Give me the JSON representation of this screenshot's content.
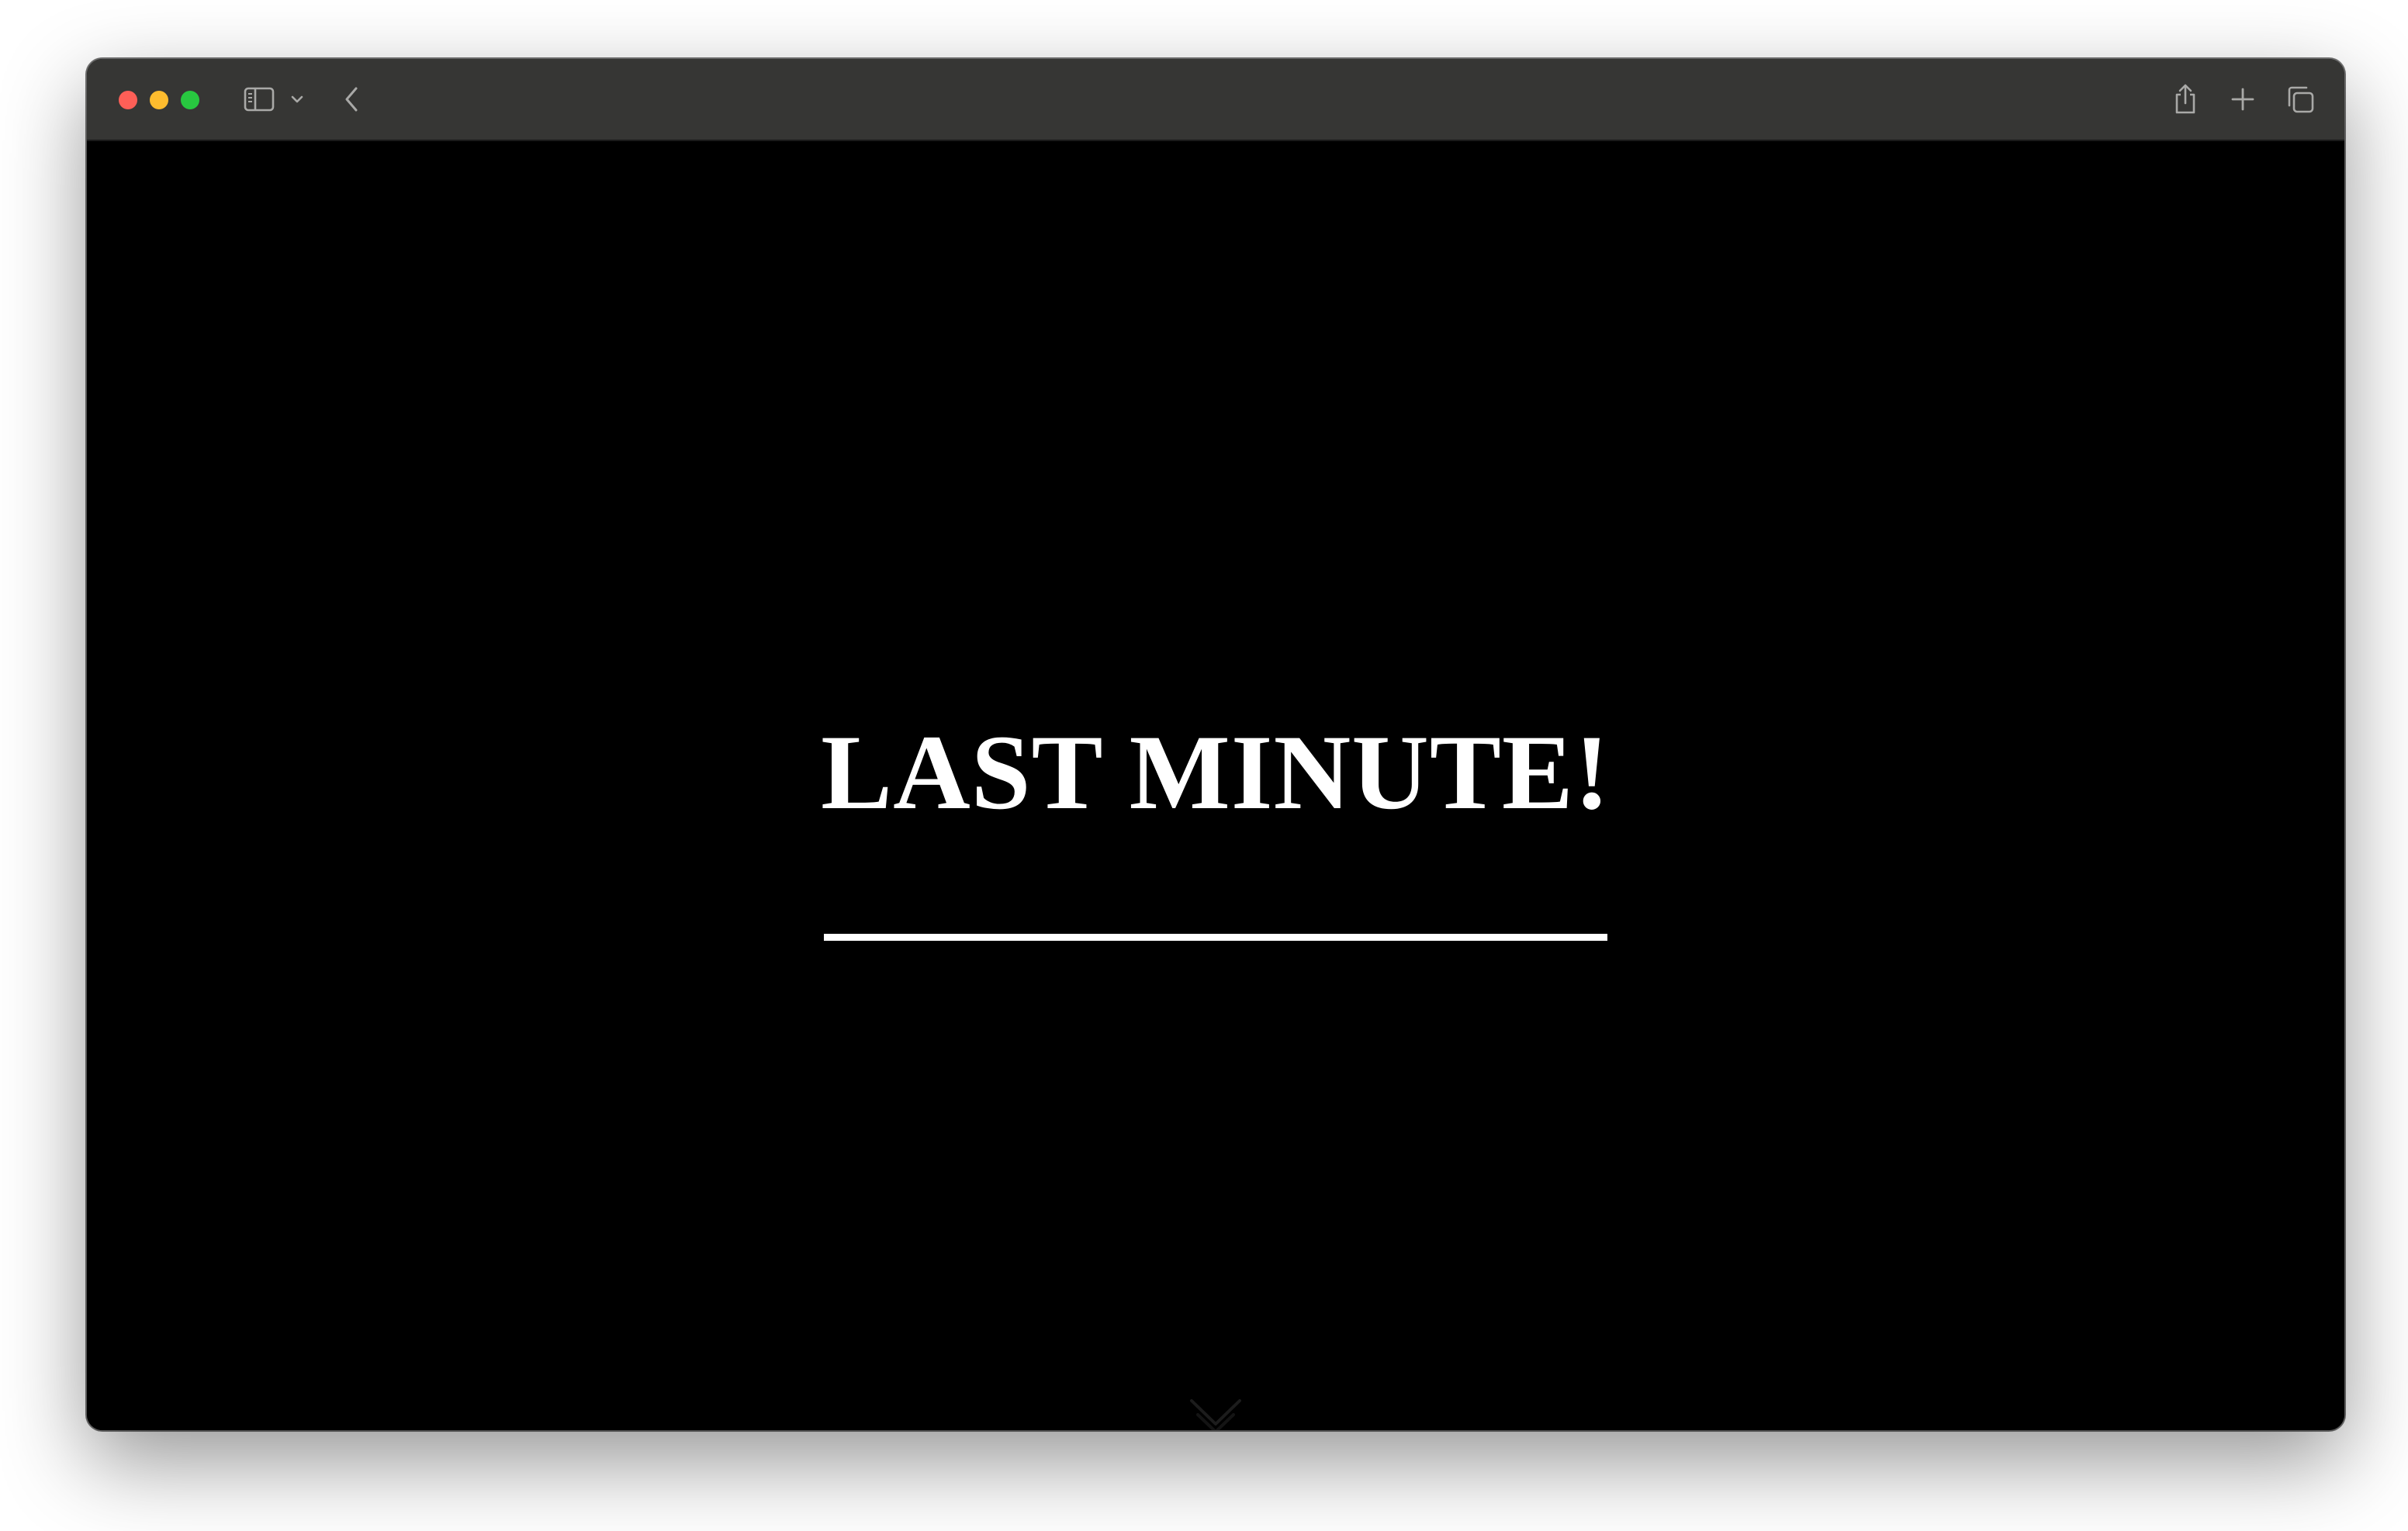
{
  "browser": {
    "toolbar_color": "#363634",
    "traffic_lights": {
      "close_color": "#fe5f57",
      "minimize_color": "#febc2e",
      "zoom_color": "#28c840"
    },
    "icons": {
      "sidebar": "sidebar-toggle-icon",
      "sidebar_menu": "chevron-down-icon",
      "back": "chevron-left-icon",
      "share": "share-icon",
      "new_tab": "plus-icon",
      "tab_overview": "tabs-overview-icon"
    }
  },
  "page": {
    "background": "#000000",
    "hero_title": "LAST MINUTE!",
    "accent_color": "#ffffff",
    "scroll_hint_icon": "chevron-down-icon"
  }
}
